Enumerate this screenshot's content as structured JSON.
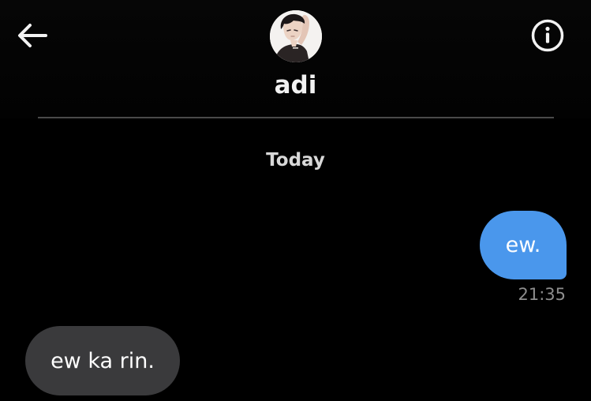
{
  "header": {
    "contact_name": "adi",
    "back_icon": "arrow-left-icon",
    "info_icon": "info-circle-icon"
  },
  "conversation": {
    "date_separator": "Today",
    "messages": [
      {
        "direction": "sent",
        "text": "ew.",
        "time": "21:35"
      },
      {
        "direction": "received",
        "text": "ew ka rin."
      }
    ]
  },
  "colors": {
    "background": "#000000",
    "sent_bubble": "#4a97ec",
    "received_bubble": "#3a3a3c",
    "text": "#ffffff",
    "muted_text": "#8e8e8e"
  }
}
